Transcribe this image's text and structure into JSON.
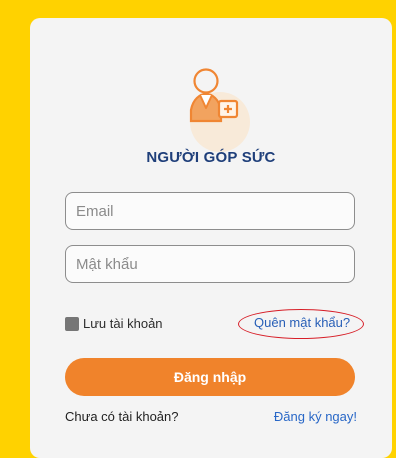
{
  "colors": {
    "page_background": "#ffd200",
    "card_background": "#f4f4f4",
    "title": "#1f3f7a",
    "field_border": "#8d8d8d",
    "primary_button": "#f0832b",
    "link": "#285fb7",
    "highlight_ellipse": "#d71f28",
    "checkbox": "#767676"
  },
  "header": {
    "title": "NGƯỜI GÓP SỨC",
    "icon": "add-user-icon"
  },
  "form": {
    "email": {
      "placeholder": "Email",
      "value": ""
    },
    "password": {
      "placeholder": "Mật khẩu",
      "value": ""
    },
    "remember_label": "Lưu tài khoản",
    "forgot_label": "Quên mật khẩu?",
    "submit_label": "Đăng nhập"
  },
  "footer": {
    "prompt": "Chưa có tài khoản?",
    "register_label": "Đăng ký ngay!"
  }
}
